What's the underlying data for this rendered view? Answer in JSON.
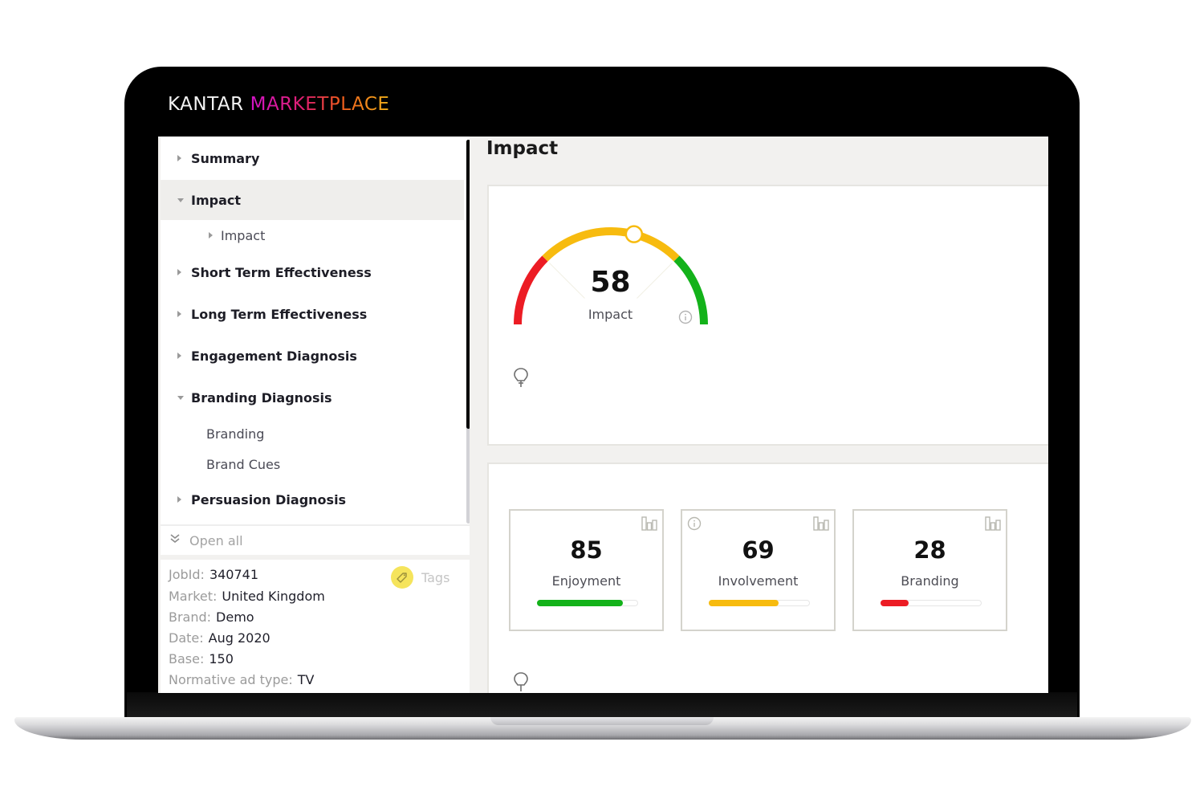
{
  "app": {
    "brand_primary": "KANTAR",
    "brand_secondary": "MARKETPLACE"
  },
  "sidebar": {
    "nav": [
      {
        "label": "Summary",
        "expanded": false
      },
      {
        "label": "Impact",
        "expanded": true,
        "active": true,
        "children": [
          {
            "label": "Impact",
            "has_arrow": true
          }
        ]
      },
      {
        "label": "Short Term Effectiveness",
        "expanded": false
      },
      {
        "label": "Long Term Effectiveness",
        "expanded": false
      },
      {
        "label": "Engagement Diagnosis",
        "expanded": false
      },
      {
        "label": "Branding Diagnosis",
        "expanded": true,
        "children": [
          {
            "label": "Branding"
          },
          {
            "label": "Brand Cues"
          }
        ]
      },
      {
        "label": "Persuasion Diagnosis",
        "expanded": false
      }
    ],
    "open_all_label": "Open all",
    "tags_label": "Tags",
    "info": [
      {
        "key": "JobId:",
        "value": "340741"
      },
      {
        "key": "Market:",
        "value": "United Kingdom"
      },
      {
        "key": "Brand:",
        "value": "Demo"
      },
      {
        "key": "Date:",
        "value": "Aug 2020"
      },
      {
        "key": "Base:",
        "value": "150"
      },
      {
        "key": "Normative ad type:",
        "value": "TV"
      }
    ]
  },
  "main": {
    "title": "Impact",
    "gauge": {
      "value": "58",
      "value_num": 58,
      "label": "Impact",
      "range": [
        0,
        100
      ],
      "bands": [
        {
          "from": 0,
          "to": 25,
          "color": "#ec1c24"
        },
        {
          "from": 25,
          "to": 75,
          "color": "#f7bb0f"
        },
        {
          "from": 75,
          "to": 100,
          "color": "#13b21a"
        }
      ]
    },
    "metrics": [
      {
        "value": "85",
        "value_num": 85,
        "label": "Enjoyment",
        "color": "#13b21a",
        "info": false
      },
      {
        "value": "69",
        "value_num": 69,
        "label": "Involvement",
        "color": "#f7bb0f",
        "info": true
      },
      {
        "value": "28",
        "value_num": 28,
        "label": "Branding",
        "color": "#ec1c24",
        "info": false
      }
    ]
  }
}
